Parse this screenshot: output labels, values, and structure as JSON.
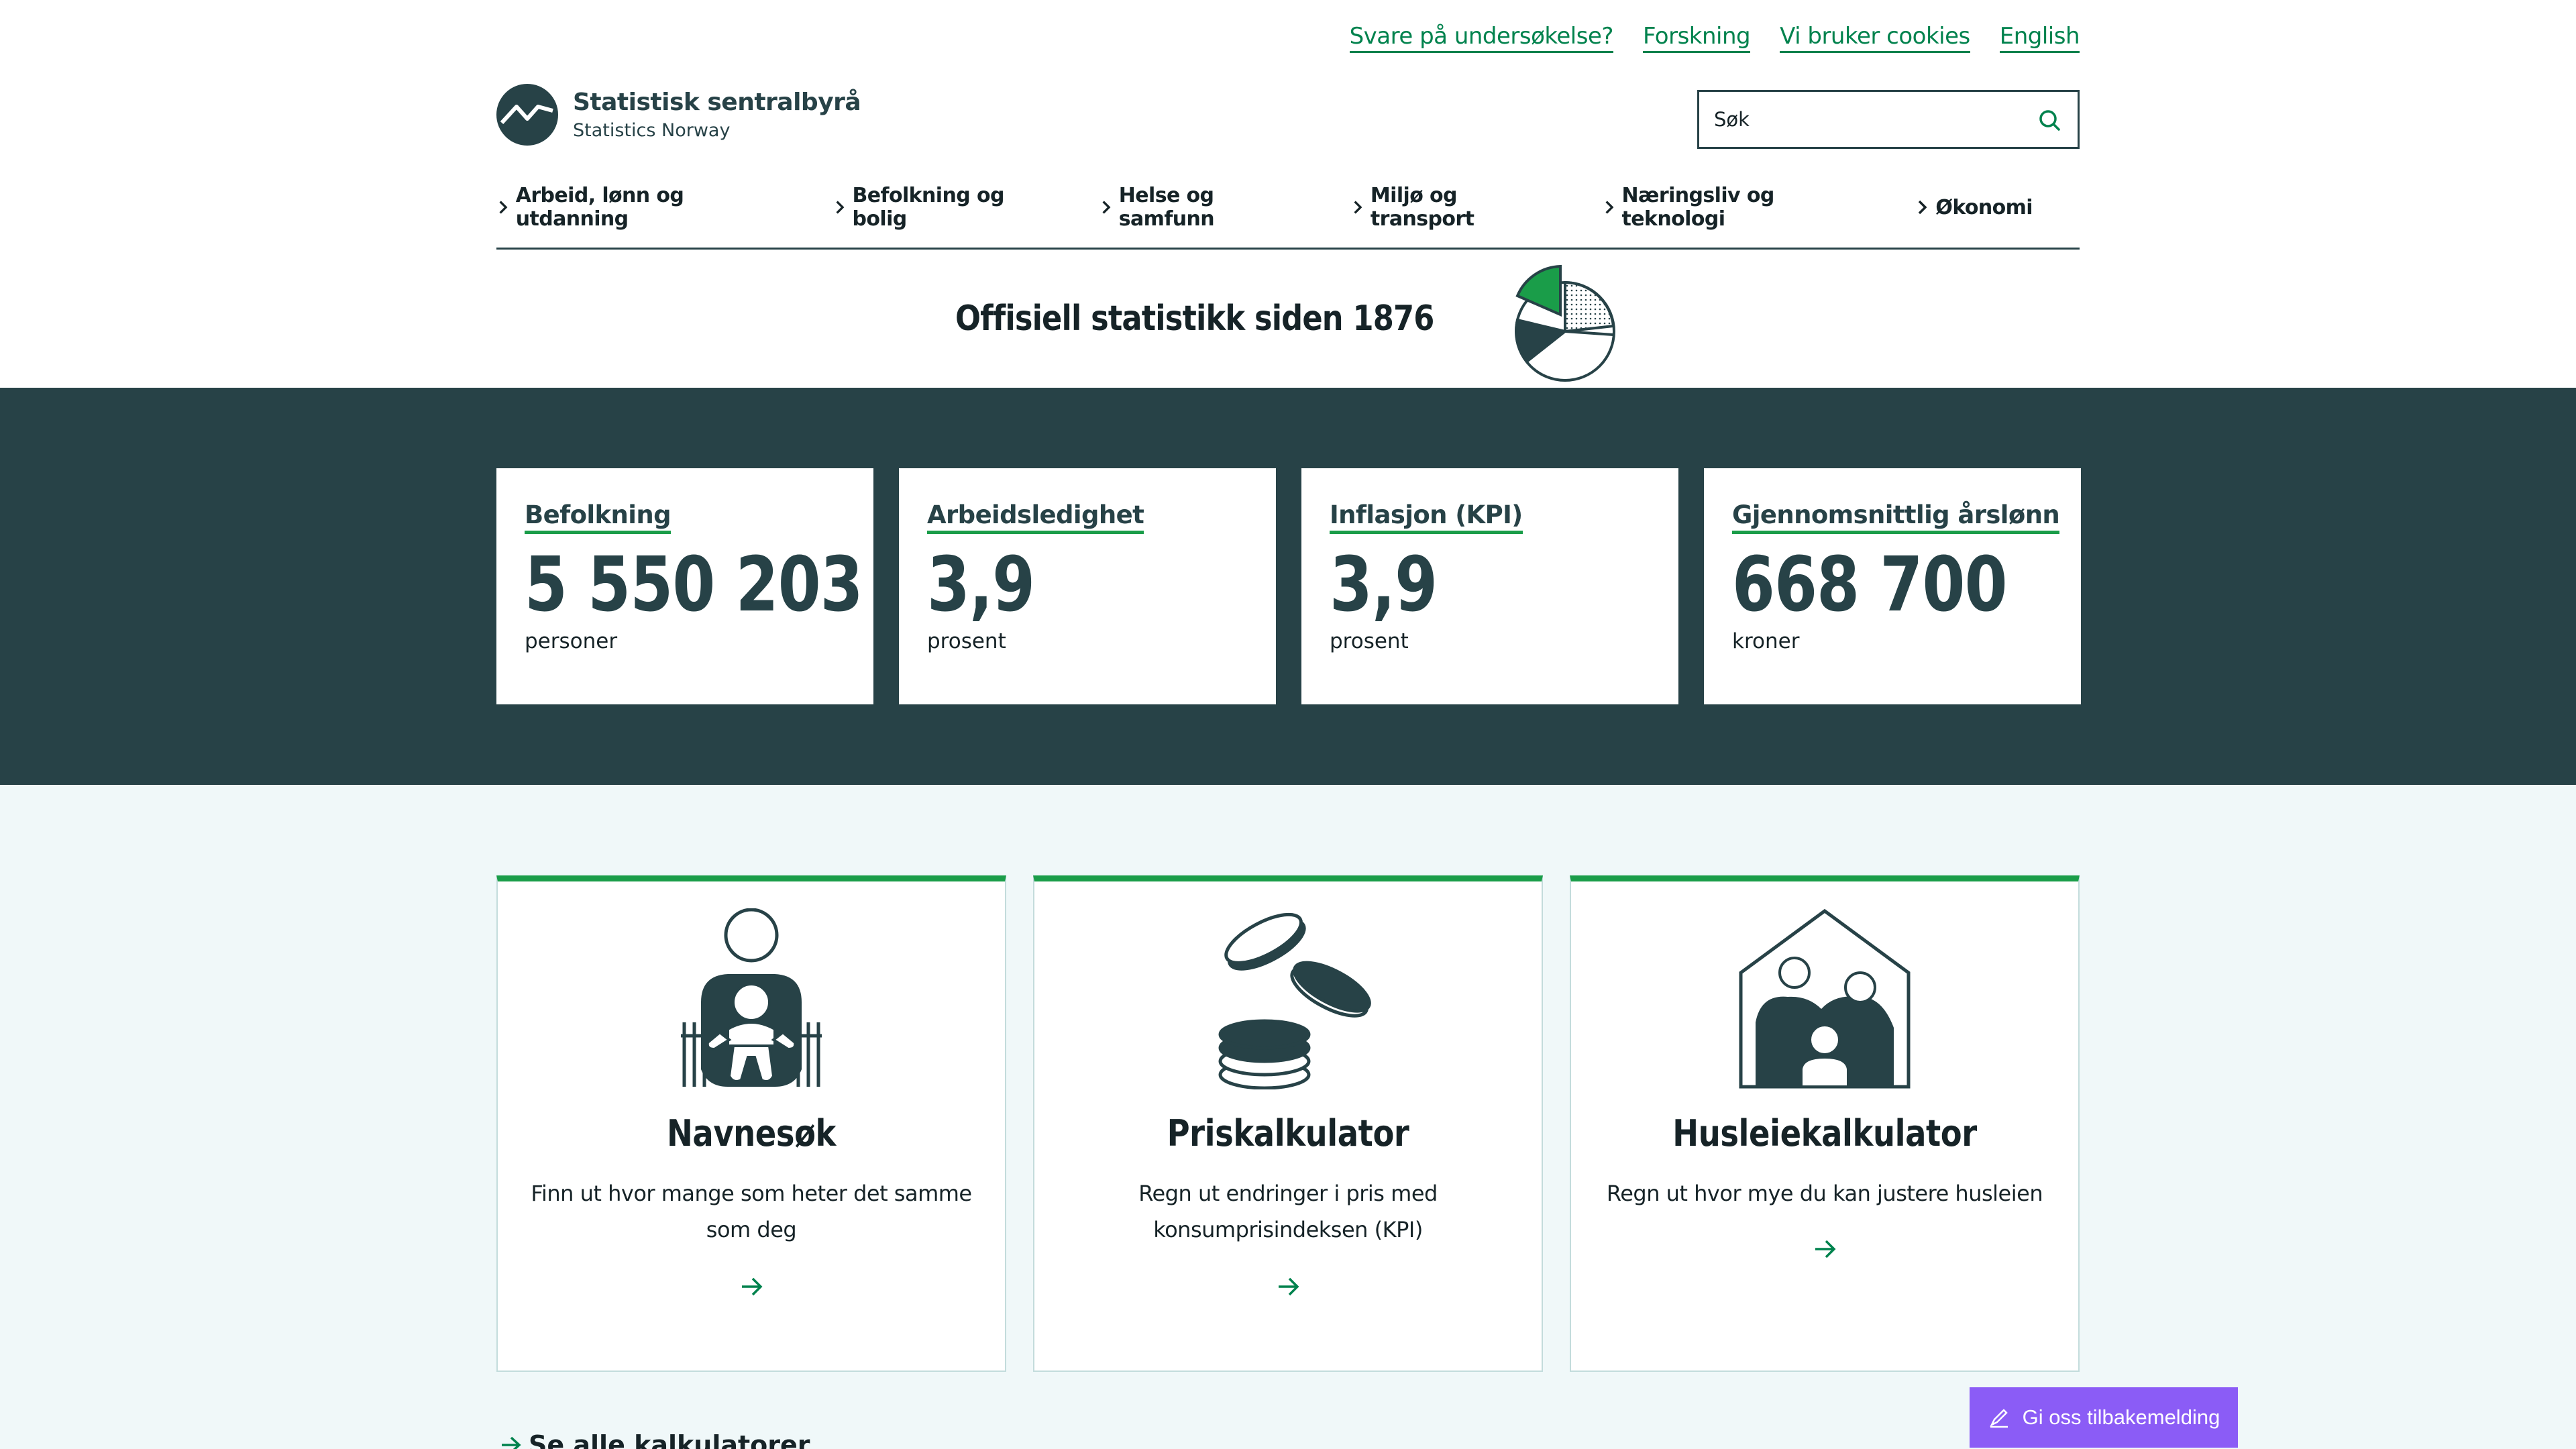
{
  "top_links": [
    "Svare på undersøkelse?",
    "Forskning",
    "Vi bruker cookies",
    "English"
  ],
  "logo": {
    "title": "Statistisk sentralbyrå",
    "subtitle": "Statistics Norway"
  },
  "search": {
    "placeholder": "Søk",
    "icon": "search-icon"
  },
  "nav": {
    "items": [
      "Arbeid, lønn og utdanning",
      "Befolkning og bolig",
      "Helse og samfunn",
      "Miljø og transport",
      "Næringsliv og teknologi",
      "Økonomi"
    ],
    "icon": "chevron-right-icon"
  },
  "hero": {
    "title": "Offisiell statistikk siden 1876",
    "icon": "pie-chart-illustration"
  },
  "key_figures": [
    {
      "label": "Befolkning",
      "value": "5 550 203",
      "unit": "personer"
    },
    {
      "label": "Arbeidsledighet",
      "value": "3,9",
      "unit": "prosent"
    },
    {
      "label": "Inflasjon (KPI)",
      "value": "3,9",
      "unit": "prosent"
    },
    {
      "label": "Gjennomsnittlig årslønn",
      "value": "668 700",
      "unit": "kroner"
    }
  ],
  "calculators": [
    {
      "title": "Navnesøk",
      "desc_lines": [
        "Finn ut hvor mange som heter det samme",
        "som deg"
      ],
      "icon": "baby-parent-illustration"
    },
    {
      "title": "Priskalkulator",
      "desc_lines": [
        "Regn ut endringer i pris med",
        "konsumprisindeksen (KPI)"
      ],
      "icon": "coins-illustration"
    },
    {
      "title": "Husleiekalkulator",
      "desc_lines": [
        "Regn ut hvor mye du kan justere husleien"
      ],
      "icon": "house-family-illustration"
    }
  ],
  "see_all": "Se alle kalkulatorer",
  "feedback": {
    "label": "Gi oss tilbakemelding",
    "icon": "pencil-icon"
  },
  "colors": {
    "dark": "#274247",
    "green": "#1a9d49",
    "link": "#00824d",
    "light_bg": "#f0f8f9",
    "feedback": "#8b5cf6"
  }
}
